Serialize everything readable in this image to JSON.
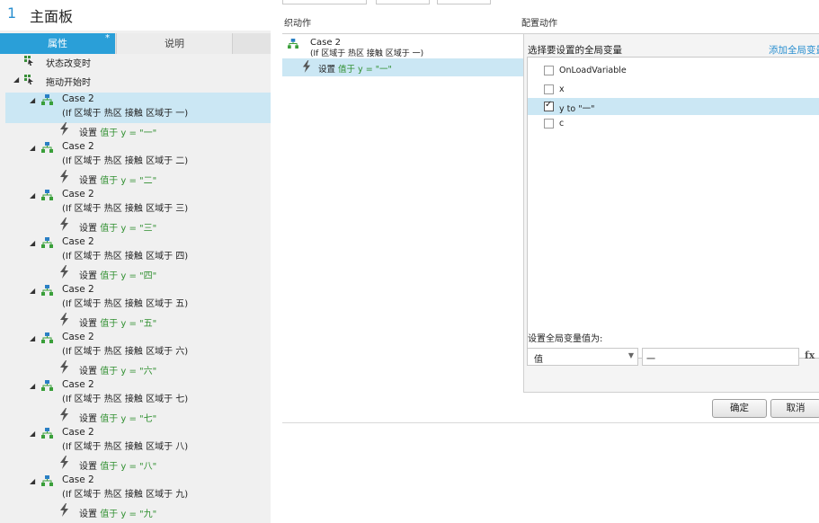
{
  "page": {
    "number": "1",
    "name": "主面板"
  },
  "tabs": {
    "properties": "属性",
    "notes": "说明",
    "star": "*"
  },
  "events": [
    {
      "label": "状态改变时"
    },
    {
      "label": "拖动开始时"
    }
  ],
  "cases": [
    {
      "name": "Case 2",
      "condition": "(If 区域于 热区 接触 区域于 一)",
      "action_prefix": "设置 ",
      "action_value": "值于 y = \"一\""
    },
    {
      "name": "Case 2",
      "condition": "(If 区域于 热区 接触 区域于 二)",
      "action_prefix": "设置 ",
      "action_value": "值于 y = \"二\""
    },
    {
      "name": "Case 2",
      "condition": "(If 区域于 热区 接触 区域于 三)",
      "action_prefix": "设置 ",
      "action_value": "值于 y = \"三\""
    },
    {
      "name": "Case 2",
      "condition": "(If 区域于 热区 接触 区域于 四)",
      "action_prefix": "设置 ",
      "action_value": "值于 y = \"四\""
    },
    {
      "name": "Case 2",
      "condition": "(If 区域于 热区 接触 区域于 五)",
      "action_prefix": "设置 ",
      "action_value": "值于 y = \"五\""
    },
    {
      "name": "Case 2",
      "condition": "(If 区域于 热区 接触 区域于 六)",
      "action_prefix": "设置 ",
      "action_value": "值于 y = \"六\""
    },
    {
      "name": "Case 2",
      "condition": "(If 区域于 热区 接触 区域于 七)",
      "action_prefix": "设置 ",
      "action_value": "值于 y = \"七\""
    },
    {
      "name": "Case 2",
      "condition": "(If 区域于 热区 接触 区域于 八)",
      "action_prefix": "设置 ",
      "action_value": "值于 y = \"八\""
    },
    {
      "name": "Case 2",
      "condition": "(If 区域于 热区 接触 区域于 九)",
      "action_prefix": "设置 ",
      "action_value": "值于 y = \"九\""
    }
  ],
  "organize": {
    "title": "织动作",
    "case_name": "Case 2",
    "case_condition": "(If 区域于 热区 接触 区域于 一)",
    "action_prefix": "设置 ",
    "action_value": "值于 y = \"一\""
  },
  "configure": {
    "title": "配置动作",
    "var_header": "选择要设置的全局变量",
    "add_var": "添加全局变量",
    "variables": [
      {
        "label": "OnLoadVariable",
        "checked": false
      },
      {
        "label": "x",
        "checked": false
      },
      {
        "label": "y to \"一\"",
        "checked": true
      },
      {
        "label": "c",
        "checked": false
      }
    ],
    "set_label": "设置全局变量值为:",
    "type_value": "值",
    "input_value": "一",
    "fx": "fx",
    "ok": "确定",
    "cancel": "取消"
  },
  "colors": {
    "accent": "#2a9fd8",
    "selection": "#cbe7f4",
    "action_value": "#2f8f2f"
  },
  "icons": {
    "event": "event-flag-icon",
    "case": "case-icon",
    "action": "lightning-icon",
    "expand": "triangle-expand-icon",
    "dropdown": "chevron-down-icon"
  }
}
